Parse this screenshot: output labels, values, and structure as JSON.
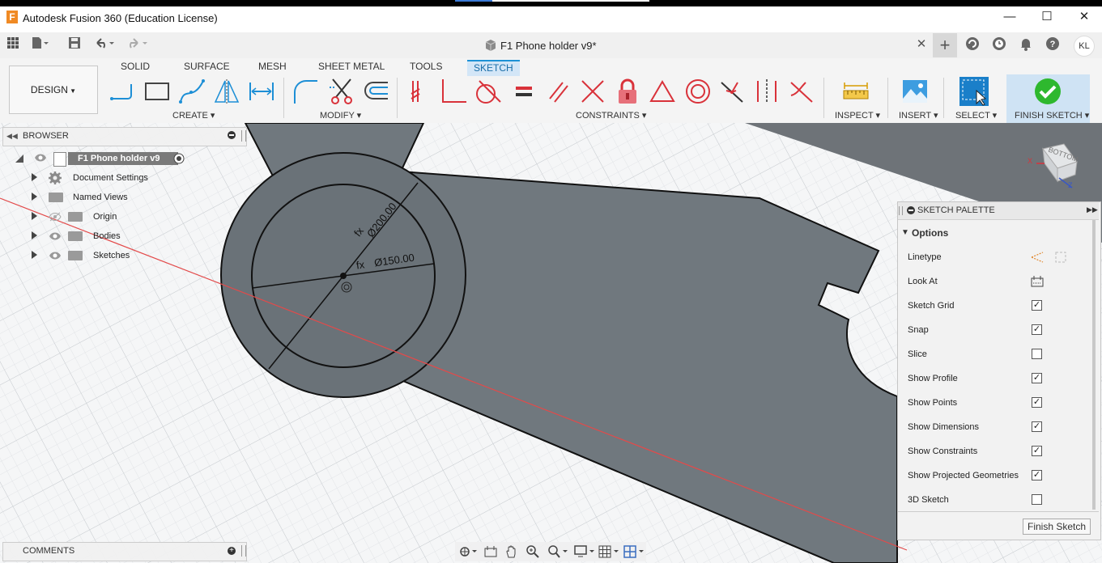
{
  "app": {
    "title": "Autodesk Fusion 360 (Education License)",
    "logo_letter": "F",
    "window_controls": {
      "minimize": "—",
      "maximize": "☐",
      "close": "✕"
    }
  },
  "document": {
    "title": "F1 Phone holder v9*",
    "close": "✕",
    "new_tab": "+",
    "user_initials": "KL"
  },
  "ribbon": {
    "workspace": "DESIGN",
    "tabs": [
      "SOLID",
      "SURFACE",
      "MESH",
      "SHEET METAL",
      "TOOLS",
      "SKETCH"
    ],
    "active_tab": "SKETCH",
    "groups": {
      "create": "CREATE",
      "modify": "MODIFY",
      "constraints": "CONSTRAINTS",
      "inspect": "INSPECT",
      "insert": "INSERT",
      "select": "SELECT",
      "finish": "FINISH SKETCH"
    },
    "colors": {
      "accent": "#1d91d6",
      "constraint_red": "#d9323a",
      "finish_green": "#2eb82e"
    }
  },
  "browser": {
    "title": "BROWSER",
    "root": "F1 Phone holder v9",
    "items": [
      {
        "label": "Document Settings",
        "icon": "gear-icon"
      },
      {
        "label": "Named Views",
        "icon": "folder-icon"
      },
      {
        "label": "Origin",
        "icon": "folder-icon"
      },
      {
        "label": "Bodies",
        "icon": "folder-icon"
      },
      {
        "label": "Sketches",
        "icon": "folder-icon"
      }
    ]
  },
  "canvas": {
    "dim_outer": "Ø200.00",
    "dim_inner": "Ø150.00",
    "fx": "fx",
    "viewcube": "BOTTOM",
    "axis_x": "X",
    "axis_z": "Z"
  },
  "palette": {
    "title": "SKETCH PALETTE",
    "section": "Options",
    "rows": [
      {
        "label": "Linetype",
        "type": "icons"
      },
      {
        "label": "Look At",
        "type": "icon"
      },
      {
        "label": "Sketch Grid",
        "checked": true
      },
      {
        "label": "Snap",
        "checked": true
      },
      {
        "label": "Slice",
        "checked": false
      },
      {
        "label": "Show Profile",
        "checked": true
      },
      {
        "label": "Show Points",
        "checked": true
      },
      {
        "label": "Show Dimensions",
        "checked": true
      },
      {
        "label": "Show Constraints",
        "checked": true
      },
      {
        "label": "Show Projected Geometries",
        "checked": true
      },
      {
        "label": "3D Sketch",
        "checked": false
      }
    ],
    "finish_button": "Finish Sketch"
  },
  "comments": {
    "title": "COMMENTS"
  }
}
